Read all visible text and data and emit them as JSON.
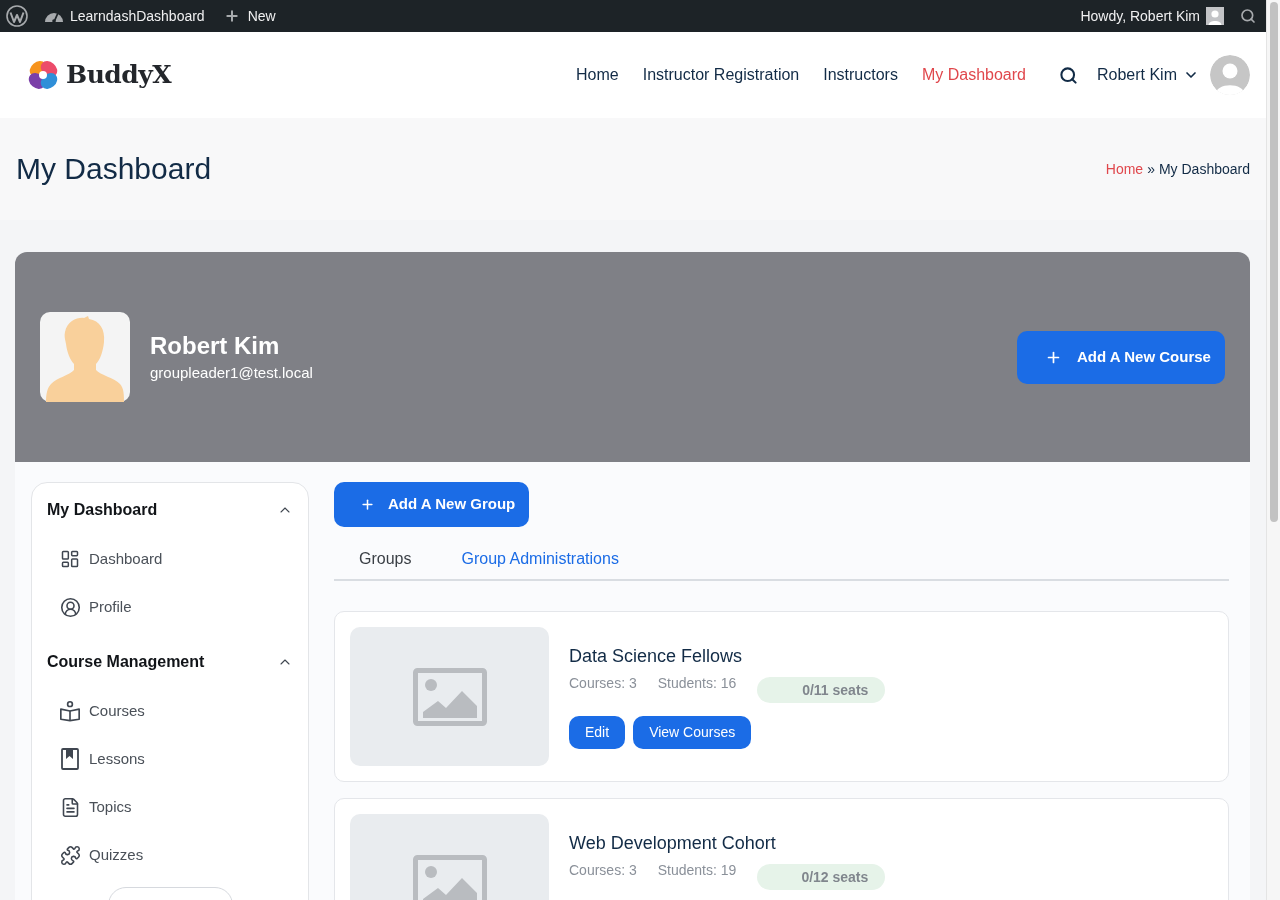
{
  "admin_bar": {
    "site_name": "LearndashDashboard",
    "new_label": "New",
    "greeting": "Howdy, Robert Kim"
  },
  "header": {
    "logo_text": "BuddyX",
    "nav": [
      {
        "label": "Home",
        "selected": false
      },
      {
        "label": "Instructor Registration",
        "selected": false
      },
      {
        "label": "Instructors",
        "selected": false
      },
      {
        "label": "My Dashboard",
        "selected": true
      }
    ],
    "user_name": "Robert Kim"
  },
  "page_header": {
    "title": "My Dashboard",
    "breadcrumb": {
      "separator": "»",
      "items": [
        {
          "label": "Home",
          "kind": "link"
        },
        {
          "label": "My Dashboard",
          "kind": "current"
        }
      ]
    }
  },
  "profile": {
    "name": "Robert Kim",
    "email": "groupleader1@test.local",
    "action": "Add A New Course"
  },
  "sidebar": {
    "sections": [
      {
        "title": "My Dashboard",
        "expanded": true,
        "items": [
          {
            "label": "Dashboard"
          },
          {
            "label": "Profile"
          }
        ]
      },
      {
        "title": "Course Management",
        "expanded": true,
        "items": [
          {
            "label": "Courses"
          },
          {
            "label": "Lessons"
          },
          {
            "label": "Topics"
          },
          {
            "label": "Quizzes"
          }
        ]
      }
    ]
  },
  "groups": {
    "action": "Add A New Group",
    "tabs": [
      {
        "label": "Groups",
        "selected": false
      },
      {
        "label": "Group Administrations",
        "selected": true
      }
    ],
    "cards": [
      {
        "title": "Data Science Fellows",
        "courses": "Courses: 3",
        "students": "Students: 16",
        "seats": "0/11 seats",
        "actions": [
          "Edit",
          "View Courses"
        ]
      },
      {
        "title": "Web Development Cohort",
        "courses": "Courses: 3",
        "students": "Students: 19",
        "seats": "0/12 seats"
      }
    ]
  }
}
